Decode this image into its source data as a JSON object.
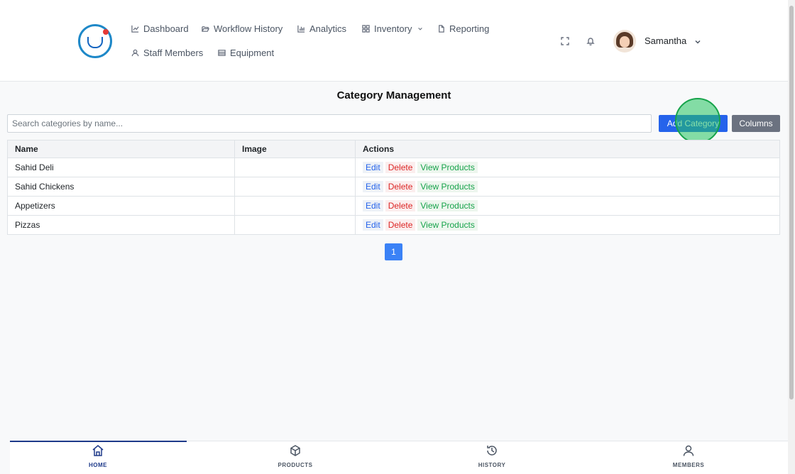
{
  "nav": {
    "dashboard": "Dashboard",
    "workflow_history": "Workflow History",
    "analytics": "Analytics",
    "inventory": "Inventory",
    "reporting": "Reporting",
    "staff_members": "Staff Members",
    "equipment": "Equipment"
  },
  "user": {
    "name": "Samantha"
  },
  "page": {
    "title": "Category Management"
  },
  "search": {
    "placeholder": "Search categories by name..."
  },
  "buttons": {
    "add_category": "Add Category",
    "columns": "Columns"
  },
  "table": {
    "headers": [
      "Name",
      "Image",
      "Actions"
    ],
    "action_labels": {
      "edit": "Edit",
      "delete": "Delete",
      "view": "View Products"
    },
    "rows": [
      {
        "name": "Sahid Deli",
        "image": ""
      },
      {
        "name": "Sahid Chickens",
        "image": ""
      },
      {
        "name": "Appetizers",
        "image": ""
      },
      {
        "name": "Pizzas",
        "image": ""
      }
    ]
  },
  "pagination": {
    "current": "1"
  },
  "bottom_nav": {
    "home": "HOME",
    "products": "PRODUCTS",
    "history": "HISTORY",
    "members": "MEMBERS"
  },
  "colors": {
    "primary": "#2563eb",
    "secondary": "#6b7280",
    "danger": "#dc2626",
    "success": "#16a34a",
    "nav_active": "#1e3a8a"
  }
}
